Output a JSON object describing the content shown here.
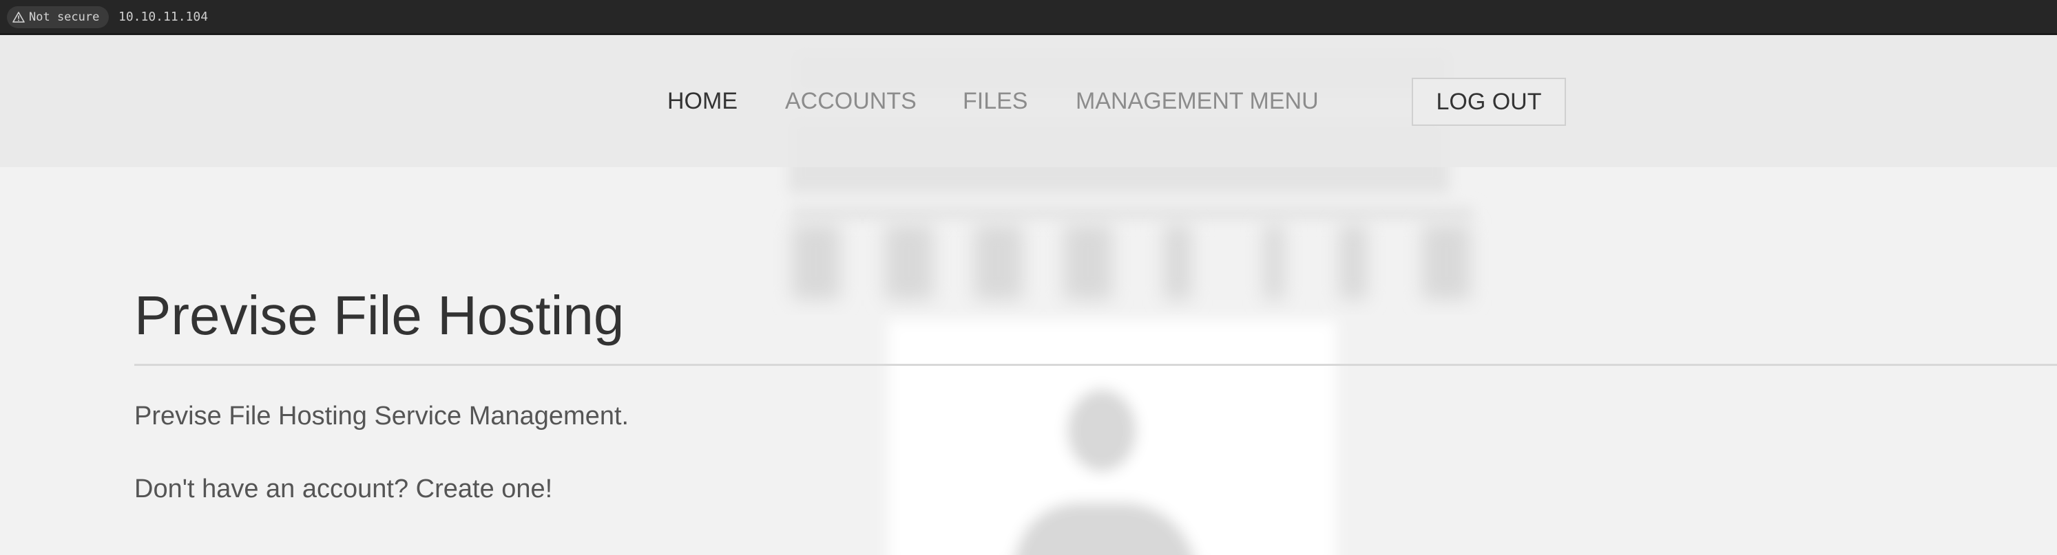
{
  "browser": {
    "security_label": "Not secure",
    "url": "10.10.11.104"
  },
  "nav": {
    "home": "HOME",
    "accounts": "ACCOUNTS",
    "files": "FILES",
    "management_menu": "MANAGEMENT MENU",
    "logout": "LOG OUT"
  },
  "main": {
    "title": "Previse File Hosting",
    "description": "Previse File Hosting Service Management.",
    "create_account_prompt": "Don't have an account? Create one!"
  },
  "colors": {
    "url_bar": "#262626",
    "page_background": "#f2f2f2",
    "nav_background": "#e9e9e9",
    "active_nav": "#333333",
    "inactive_nav": "#8c8c8c"
  }
}
